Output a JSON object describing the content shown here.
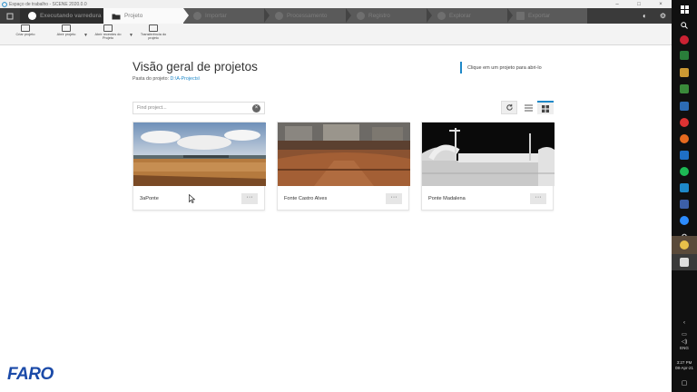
{
  "window": {
    "title": "Espaço de trabalho - SCENE 2020.0.0"
  },
  "tabs": {
    "scan": "Executando varredura",
    "project": "Projeto",
    "import": "Importar",
    "process": "Processamento",
    "register": "Registro",
    "explore": "Explorar",
    "export": "Exportar"
  },
  "ribbon": {
    "create": "Criar projeto",
    "open": "Abrir projeto",
    "open_recent": "Abrir recentes do Projeto",
    "transfer": "Transferência do projeto"
  },
  "main": {
    "title": "Visão geral de projetos",
    "folder_label": "Pasta do projeto:",
    "folder_path": "D:\\A-Projects\\",
    "hint": "Clique em um projeto para abri-lo",
    "search_placeholder": "Find project..."
  },
  "projects": [
    {
      "name": "3aPonte",
      "menu": "···"
    },
    {
      "name": "Fonte Castro Alves",
      "menu": "···"
    },
    {
      "name": "Ponte Madalena",
      "menu": "···"
    }
  ],
  "brand": {
    "logo_text": "FARO",
    "logo_color": "#1b4aa8",
    "accent": "#1e88c8"
  },
  "taskbar": {
    "lang": "ENG",
    "time": "3:27 PM",
    "date": "08-Apr-21"
  }
}
